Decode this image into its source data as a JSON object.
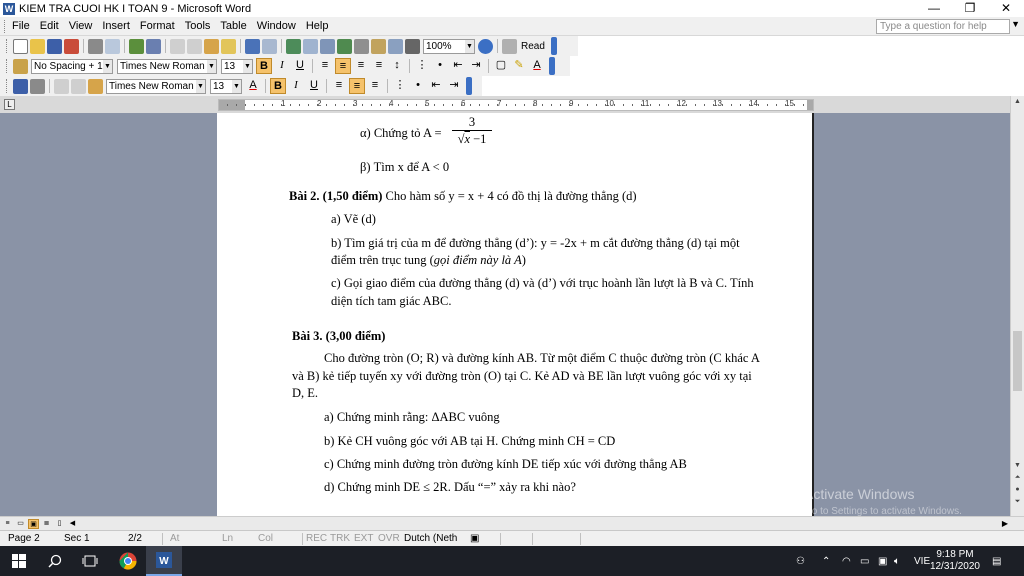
{
  "window": {
    "title": "KIEM TRA CUOI HK I TOAN 9 - Microsoft Word",
    "app_icon": "W",
    "buttons": [
      "—",
      "❐",
      "✕"
    ]
  },
  "menu": {
    "items": [
      "File",
      "Edit",
      "View",
      "Insert",
      "Format",
      "Tools",
      "Table",
      "Window",
      "Help"
    ],
    "help_placeholder": "Type a question for help"
  },
  "toolbar1": {
    "zoom": "100%",
    "read_label": "Read"
  },
  "toolbar2": {
    "style": "No Spacing + 13",
    "font": "Times New Roman",
    "size": "13"
  },
  "toolbar3": {
    "font": "Times New Roman",
    "size": "13"
  },
  "ruler": {
    "numbers": [
      "2",
      "1",
      "1",
      "2",
      "3",
      "4",
      "5",
      "6",
      "7",
      "8",
      "9",
      "10",
      "11",
      "12",
      "13",
      "14",
      "15",
      "16"
    ]
  },
  "document": {
    "lines": [
      "α) Chứng tỏ A =",
      "β) Tìm x để A < 0",
      "Bài 2. (1,50 điểm)",
      "Cho hàm số y = x + 4 có đồ thị là đường thẳng (d)",
      "a) Vẽ (d)",
      "b) Tìm giá trị của m để đường thẳng (d’): y = -2x + m cắt đường thẳng (d) tại một",
      "điểm trên trục tung (",
      "gọi điểm này là A",
      ")",
      "c) Gọi giao điểm của đường thẳng (d) và (d’) với trục hoành lần lượt là B và C. Tính",
      "diện tích tam giác ABC.",
      "Bài 3. (3,00 điểm)",
      "Cho đường tròn (O; R) và đường kính AB. Từ một điểm C thuộc đường tròn (C khác A",
      "và B) kẻ tiếp tuyến xy với đường tròn (O) tại C. Kẻ AD và BE lần lượt vuông góc với xy tại",
      "D, E.",
      "a) Chứng minh rằng: ΔABC vuông",
      "b) Kẻ CH vuông góc với AB tại H. Chứng minh CH = CD",
      "c) Chứng minh đường tròn đường kính DE tiếp xúc với đường thẳng AB",
      "d) Chứng minh DE ≤ 2R. Dấu “=” xảy ra khi nào?"
    ],
    "fraction": {
      "numerator": "3",
      "denominator_var": "x",
      "denominator_rest": " −1"
    }
  },
  "watermark": {
    "line1": "Activate Windows",
    "line2": "Go to Settings to activate Windows."
  },
  "statusbar": {
    "page": "Page 2",
    "sec": "Sec 1",
    "pages": "2/2",
    "at": "At",
    "ln": "Ln",
    "col": "Col",
    "rec": "REC",
    "trk": "TRK",
    "ext": "EXT",
    "ovr": "OVR",
    "language": "Dutch (Neth"
  },
  "taskbar": {
    "lang": "VIE",
    "time": "9:18 PM",
    "date": "12/31/2020"
  },
  "colors": {
    "accent": "#2b579a",
    "doc_background": "#8a93a6",
    "taskbar": "#1c1f26"
  }
}
